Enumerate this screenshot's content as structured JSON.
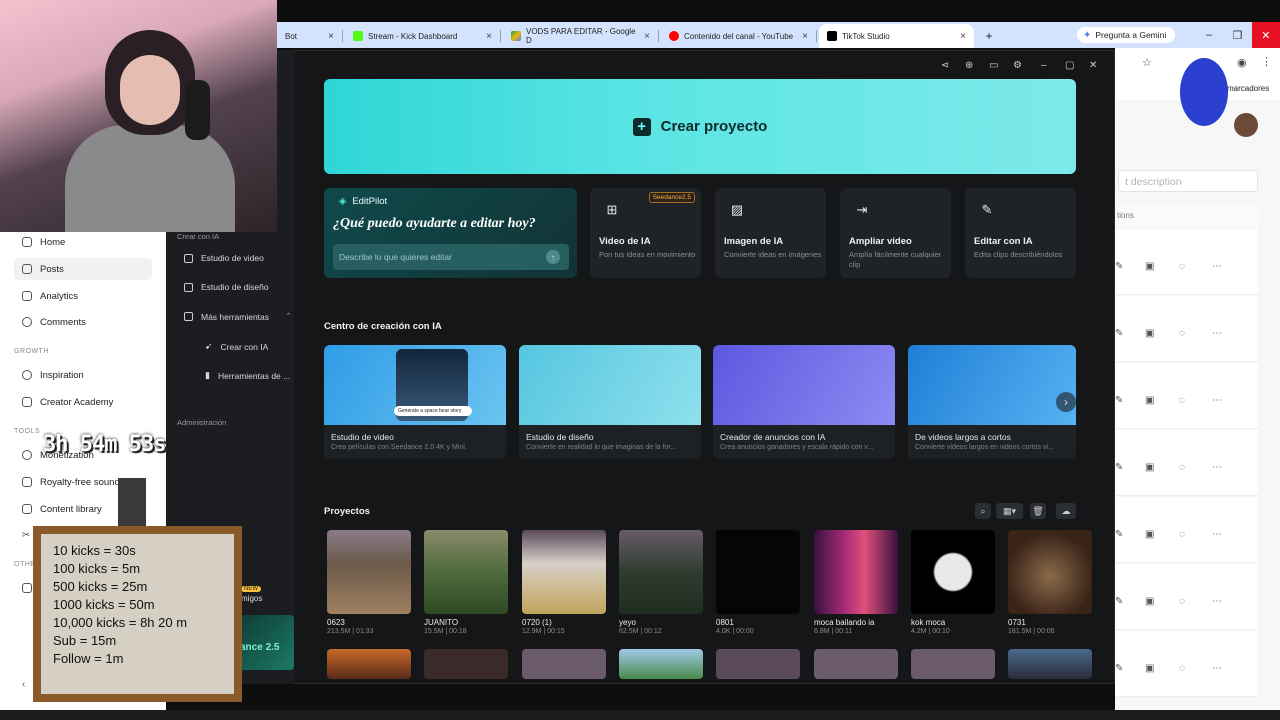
{
  "browser": {
    "tabs": [
      {
        "label": "Bot"
      },
      {
        "label": "Stream - Kick Dashboard"
      },
      {
        "label": "VODS PARA EDITAR - Google D"
      },
      {
        "label": "Contenido del canal - YouTube"
      },
      {
        "label": "TikTok Studio"
      }
    ],
    "gemini_label": "Pregunta a Gemini",
    "bookmarks_label": "marcadores",
    "new_tab": "+",
    "close_glyph": "×"
  },
  "tiktok": {
    "nav": {
      "home": "Home",
      "posts": "Posts",
      "analytics": "Analytics",
      "comments": "Comments",
      "growth_section": "GROWTH",
      "inspiration": "Inspiration",
      "creator_academy": "Creator Academy",
      "tools_section": "TOOLS",
      "monetization": "Monetization",
      "royalty_free": "Royalty-free sounds",
      "content_library": "Content library",
      "other_section": "OTHE",
      "back": "Ba"
    },
    "right": {
      "desc_placeholder": "t description",
      "actions_header": "tions"
    }
  },
  "capcut": {
    "sidebar": {
      "crear_ia_section": "Crear con IA",
      "estudio_video": "Estudio de video",
      "estudio_diseno": "Estudio de diseño",
      "mas_herramientas": "Más herramientas",
      "crear_con_ia": "Crear con IA",
      "herramientas": "Herramientas de ...",
      "admin_section": "Administración",
      "amigos": "migos",
      "new_badge": "NEW",
      "promo": "ance 2.5"
    },
    "crear_proyecto": "Crear proyecto",
    "editpilot": {
      "title": "EditPilot",
      "question": "¿Qué puedo ayudarte a editar hoy?",
      "placeholder": "Describe lo que quieres editar"
    },
    "features": [
      {
        "title": "Video de IA",
        "desc": "Pon tus ideas en movimiento",
        "badge": "Seedance2.5",
        "icon": "video-plus-icon"
      },
      {
        "title": "Imagen de IA",
        "desc": "Convierte ideas en imágenes",
        "badge": "",
        "icon": "image-plus-icon"
      },
      {
        "title": "Ampliar video",
        "desc": "Amplía fácilmente cualquier clip",
        "badge": "",
        "icon": "expand-icon"
      },
      {
        "title": "Editar con IA",
        "desc": "Edita clips describiéndolos",
        "badge": "",
        "icon": "magic-pen-icon"
      }
    ],
    "centro_title": "Centro de creación con IA",
    "cards": [
      {
        "title": "Estudio de video",
        "desc": "Crea películas con Seedance 2.0 4K y Mini.",
        "color": "#3aa6e8"
      },
      {
        "title": "Estudio de diseño",
        "desc": "Convierte en realidad lo que imaginas de la for...",
        "color": "#6fd2e6"
      },
      {
        "title": "Creador de anuncios con IA",
        "desc": "Crea anuncios ganadores y escala rápido con v...",
        "color": "#6a68e8"
      },
      {
        "title": "De videos largos a cortos",
        "desc": "Convierte videos largos en videos cortos vi...",
        "color": "#2f8fe0"
      }
    ],
    "card_overlay_text": "Generate a space bear story",
    "proyectos_title": "Proyectos",
    "projects": [
      {
        "name": "0623",
        "meta": "213.5M | 01:33",
        "color": "#6b5a4a"
      },
      {
        "name": "JUANITO",
        "meta": "15.5M | 00:18",
        "color": "#4f6b3d"
      },
      {
        "name": "0720 (1)",
        "meta": "12.9M | 00:15",
        "color": "#c0a45a"
      },
      {
        "name": "yeyo",
        "meta": "62.5M | 00:12",
        "color": "#2e3d2f"
      },
      {
        "name": "0801",
        "meta": "4.0K | 00:00",
        "color": "#050505"
      },
      {
        "name": "moca bailando ia",
        "meta": "6.8M | 00:11",
        "color": "#b0307a"
      },
      {
        "name": "kok moca",
        "meta": "4.2M | 00:10",
        "color": "#000000"
      },
      {
        "name": "0731",
        "meta": "181.5M | 00:06",
        "color": "#5a4030"
      }
    ]
  },
  "overlay": {
    "timer": "3h 54m 53s",
    "kicks": [
      "10 kicks = 30s",
      "100 kicks = 5m",
      "500 kicks = 25m",
      "1000 kicks = 50m",
      "10,000 kicks = 8h 20 m",
      "Sub = 15m",
      "Follow = 1m"
    ]
  }
}
